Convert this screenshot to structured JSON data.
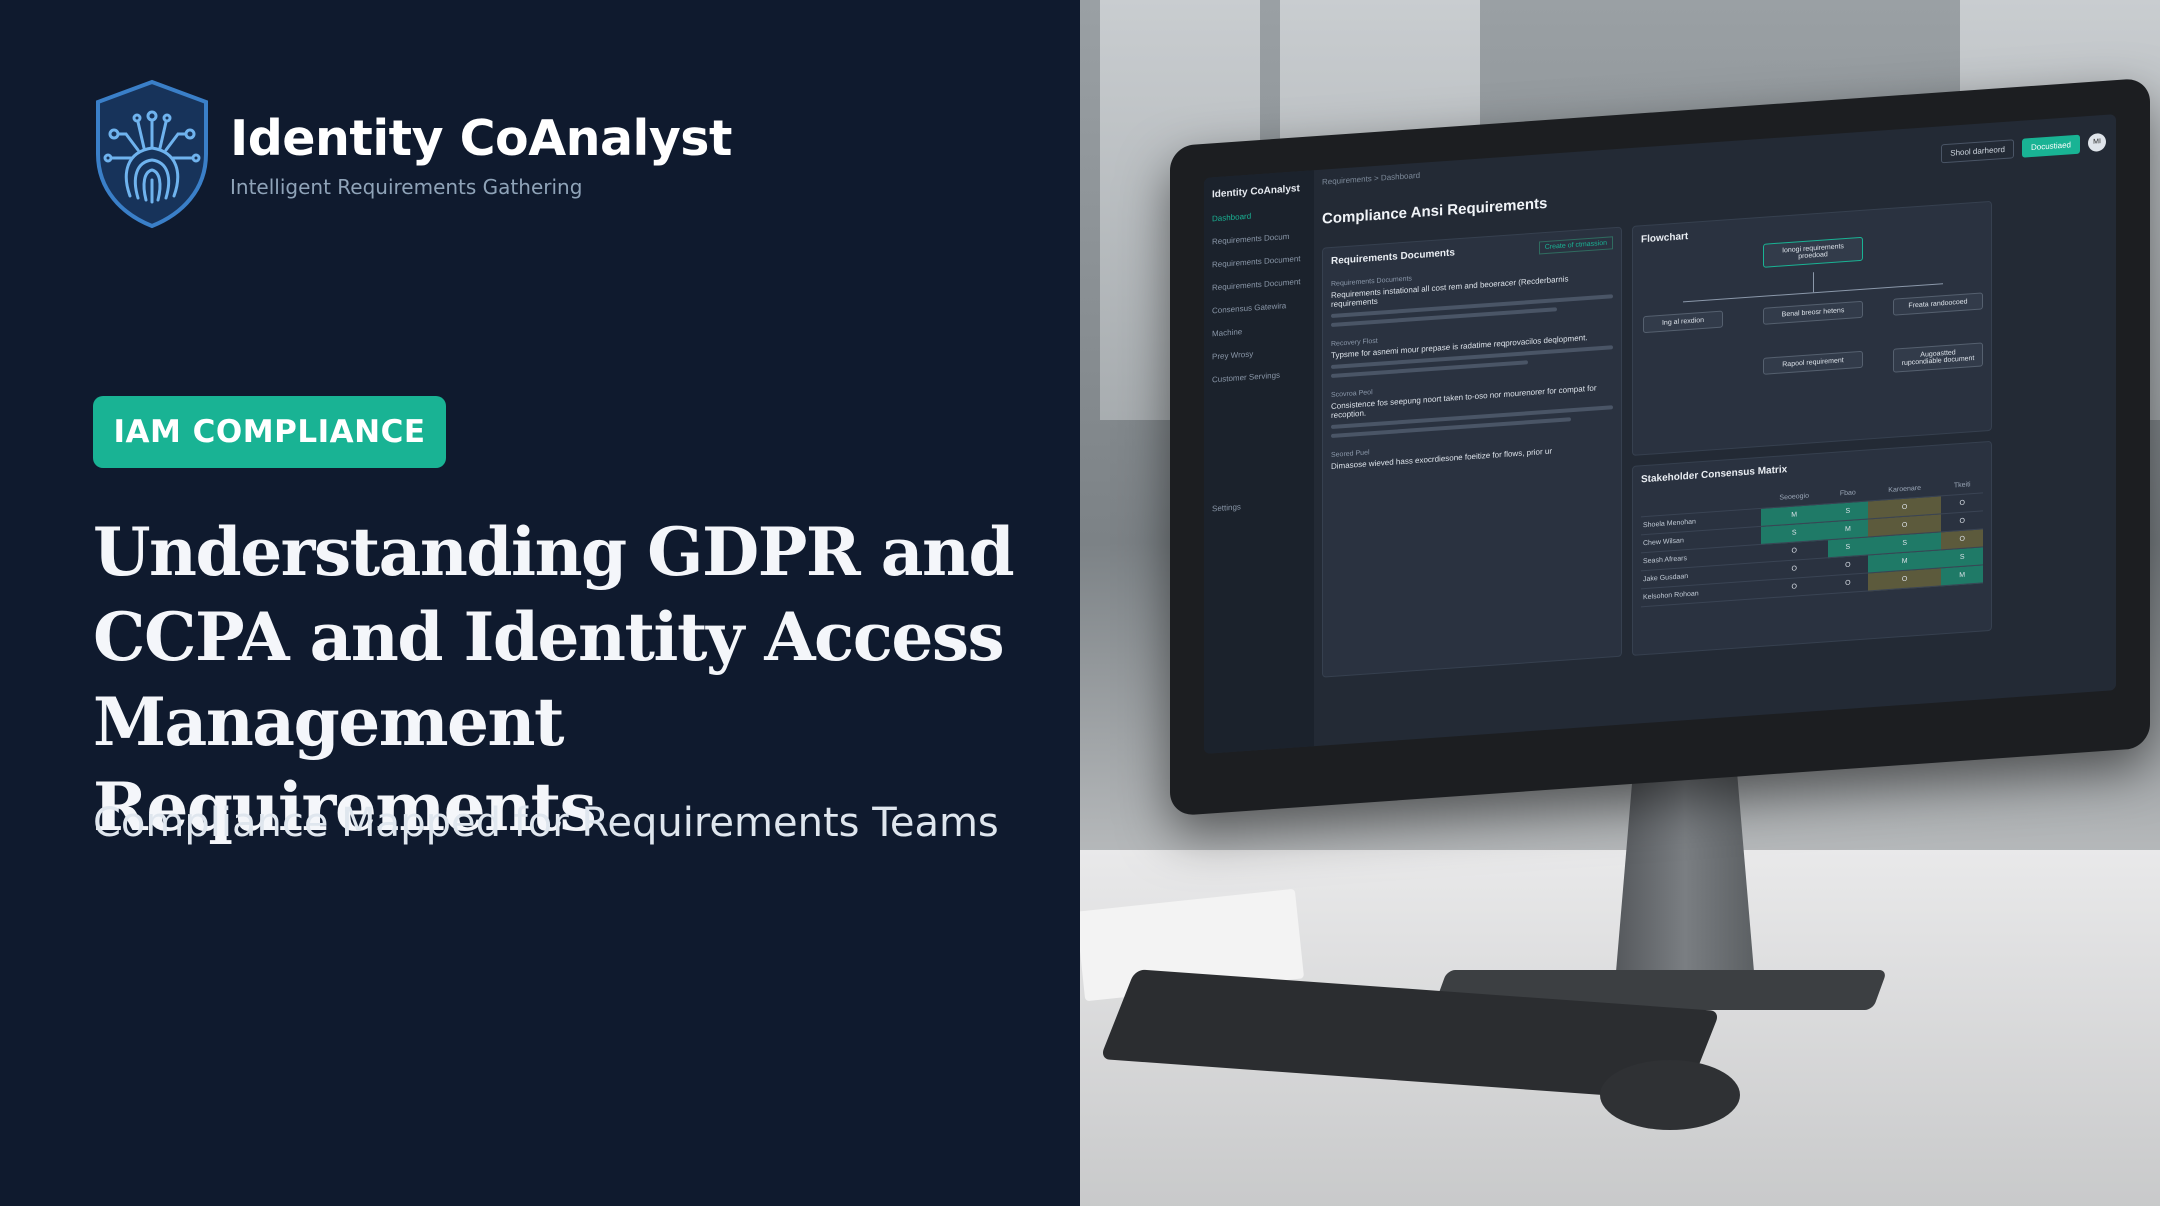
{
  "brand": {
    "name": "Identity CoAnalyst",
    "tagline": "Intelligent Requirements Gathering"
  },
  "badge": "IAM COMPLIANCE",
  "headline": {
    "line1": "Understanding GDPR and",
    "line2": "CCPA and Identity Access",
    "line3": "Management Requirements"
  },
  "subheadline": "Compliance Mapped for Requirements Teams",
  "screen": {
    "app_name": "Identity CoAnalyst",
    "breadcrumb": "Requirements  >  Dashboard",
    "page_title": "Compliance Ansi Requirements",
    "buttons": {
      "secondary": "Shool darheord",
      "primary": "Docustiaed"
    },
    "avatar_initials": "MI",
    "sidebar": [
      "Dashboard",
      "Requirements Docum",
      "Requirements Document",
      "Requirements Document",
      "Consensus Gatewira",
      "Machine",
      "Prey Wrosy",
      "Customer Servings",
      "Settings"
    ],
    "requirements_panel": {
      "title": "Requirements Documents",
      "link": "Create of ctmassion",
      "docs": [
        {
          "label": "Requirements Documents",
          "text": "Requirements instational all cost rem and beoeracer (Recderbarnis requirements"
        },
        {
          "label": "Recovery Flost",
          "text": "Typsme for asnemi mour prepase is radatime reqprovacilos deqlopment."
        },
        {
          "label": "Scovroa Peol",
          "text": "Consistence fos seepung noort taken to-oso nor mourenorer for compat for recoption."
        },
        {
          "label": "Seored Puel",
          "text": "Dimasose wieved hass exocrdiesone foeitize for flows, prior ur"
        }
      ]
    },
    "flowchart": {
      "title": "Flowchart",
      "nodes": [
        "Ionogi requirements proedoad",
        "Ing al rexdion",
        "Benal breosr hetens",
        "Freata randoocoed",
        "Rapool requirement",
        "Augoastted rupcondiable document"
      ]
    },
    "matrix": {
      "title": "Stakeholder Consensus Matrix",
      "columns": [
        "",
        "Seoeogio",
        "Fbao",
        "Karoenare",
        "Tkeiti"
      ],
      "rows": [
        {
          "name": "Shoela Menohan",
          "cells": [
            "M",
            "S",
            "O",
            "O"
          ]
        },
        {
          "name": "Chew Wilsan",
          "cells": [
            "S",
            "M",
            "O",
            "O"
          ]
        },
        {
          "name": "Seash Afrears",
          "cells": [
            "O",
            "S",
            "S",
            "O"
          ]
        },
        {
          "name": "Jake Gusdaan",
          "cells": [
            "O",
            "O",
            "M",
            "S"
          ]
        },
        {
          "name": "Kelsohon Rohoan",
          "cells": [
            "O",
            "O",
            "O",
            "M"
          ]
        }
      ]
    }
  },
  "colors": {
    "background": "#0f1a2e",
    "accent": "#19b394",
    "text": "#f4f6fa"
  }
}
